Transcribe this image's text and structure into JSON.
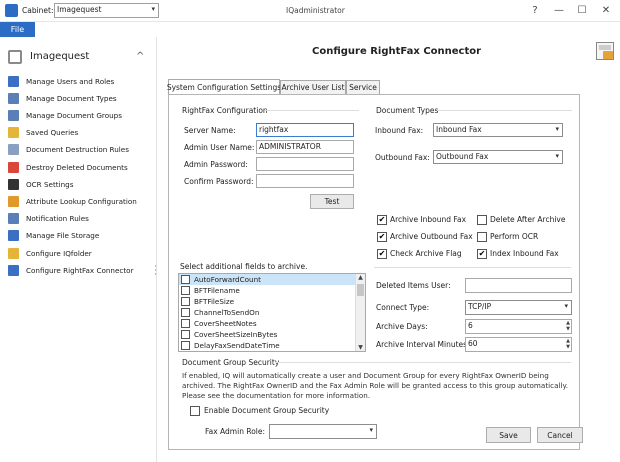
{
  "window": {
    "cabinet_label": "Cabinet:",
    "cabinet_value": "Imagequest",
    "title": "IQadministrator",
    "help_glyph": "?",
    "minimize_glyph": "—",
    "maximize_glyph": "☐",
    "close_glyph": "✕"
  },
  "menu": {
    "file": "File"
  },
  "sidebar": {
    "header": "Imagequest",
    "collapse_glyph": "^",
    "items": [
      {
        "label": "Manage Users and Roles",
        "icon": "users-icon",
        "color": "#3a6fc4"
      },
      {
        "label": "Manage Document Types",
        "icon": "document-types-icon",
        "color": "#5a7fb8"
      },
      {
        "label": "Manage Document Groups",
        "icon": "document-groups-icon",
        "color": "#5a7fb8"
      },
      {
        "label": "Saved Queries",
        "icon": "folder-icon",
        "color": "#e5b53a"
      },
      {
        "label": "Document Destruction Rules",
        "icon": "document-icon",
        "color": "#8aa0c0"
      },
      {
        "label": "Destroy Deleted Documents",
        "icon": "destroy-icon",
        "color": "#d9463a"
      },
      {
        "label": "OCR Settings",
        "icon": "ocr-icon",
        "color": "#333333"
      },
      {
        "label": "Attribute Lookup Configuration",
        "icon": "lookup-icon",
        "color": "#e09a2a"
      },
      {
        "label": "Notification Rules",
        "icon": "notification-icon",
        "color": "#5a7fb8"
      },
      {
        "label": "Manage File Storage",
        "icon": "storage-icon",
        "color": "#3a6fc4"
      },
      {
        "label": "Configure IQfolder",
        "icon": "iqfolder-icon",
        "color": "#e5b53a"
      },
      {
        "label": "Configure RightFax Connector",
        "icon": "rightfax-icon",
        "color": "#3a6fc4"
      }
    ]
  },
  "main": {
    "title": "Configure RightFax Connector",
    "tabs": [
      {
        "label": "System Configuration Settings"
      },
      {
        "label": "Archive User List"
      },
      {
        "label": "Service"
      }
    ],
    "rightfax": {
      "section_title": "RightFax Configuration",
      "server_label": "Server Name:",
      "server_value": "rightfax",
      "admin_user_label": "Admin User Name:",
      "admin_user_value": "ADMINISTRATOR",
      "admin_password_label": "Admin Password:",
      "admin_password_value": "",
      "confirm_password_label": "Confirm Password:",
      "confirm_password_value": "",
      "test_button": "Test"
    },
    "document_types": {
      "section_title": "Document Types",
      "inbound_label": "Inbound Fax:",
      "inbound_value": "Inbound Fax",
      "outbound_label": "Outbound Fax:",
      "outbound_value": "Outbound Fax"
    },
    "checkboxes": [
      {
        "label": "Archive Inbound Fax",
        "checked": true
      },
      {
        "label": "Delete After Archive",
        "checked": false
      },
      {
        "label": "Archive Outbound Fax",
        "checked": true
      },
      {
        "label": "Perform OCR",
        "checked": false
      },
      {
        "label": "Check Archive Flag",
        "checked": true
      },
      {
        "label": "Index Inbound Fax",
        "checked": true
      }
    ],
    "fields": {
      "title": "Select additional fields to archive.",
      "items": [
        "AutoForwardCount",
        "BFTFilename",
        "BFTFileSize",
        "ChannelToSendOn",
        "CoverSheetNotes",
        "CoverSheetSizeInBytes",
        "DelayFaxSendDateTime"
      ]
    },
    "settings": {
      "deleted_items_label": "Deleted Items User:",
      "deleted_items_value": "",
      "connect_type_label": "Connect Type:",
      "connect_type_value": "TCP/IP",
      "archive_days_label": "Archive Days:",
      "archive_days_value": "6",
      "archive_interval_label": "Archive Interval Minutes:",
      "archive_interval_value": "60"
    },
    "security": {
      "section_title": "Document Group Security",
      "description": "If enabled, IQ will automatically create a user and Document Group for every RightFax OwnerID being archived. The RightFax OwnerID and the Fax Admin Role will be granted access to this group automatically. Please see the documentation for more information.",
      "enable_label": "Enable Document Group Security",
      "enable_checked": false,
      "fax_admin_label": "Fax Admin Role:",
      "fax_admin_value": ""
    },
    "save_button": "Save",
    "cancel_button": "Cancel",
    "check_glyph": "✔"
  }
}
